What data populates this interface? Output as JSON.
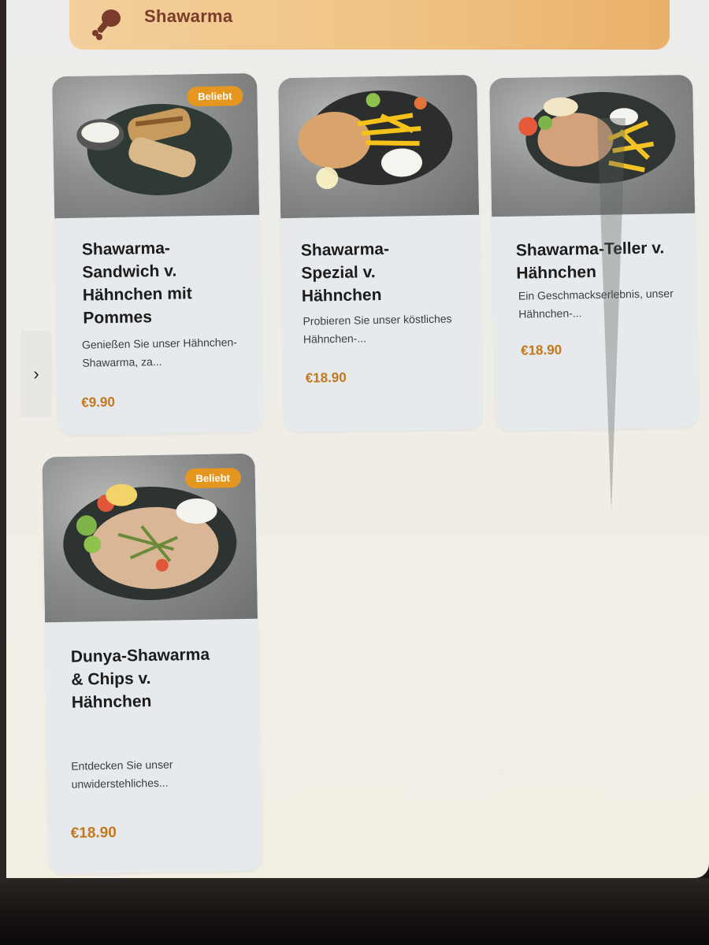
{
  "category": {
    "title": "Shawarma",
    "icon": "chicken-leg-icon",
    "accent_color": "#e5961e"
  },
  "nav": {
    "next_icon": "chevron-right-icon",
    "next_glyph": "›"
  },
  "products": [
    {
      "title": "Shawarma-Sandwich v. Hähnchen mit Pommes",
      "description": "Genießen Sie unser Hähnchen-Shawarma, za...",
      "price": "€9.90",
      "badge": "Beliebt"
    },
    {
      "title": "Shawarma-Spezial v. Hähnchen",
      "description": "Probieren Sie unser köstliches Hähnchen-...",
      "price": "€18.90",
      "badge": ""
    },
    {
      "title": "Shawarma-Teller v. Hähnchen",
      "description": "Ein Geschmackserlebnis, unser Hähnchen-...",
      "price": "€18.90",
      "badge": ""
    },
    {
      "title": "Dunya-Shawarma & Chips v. Hähnchen",
      "description": "Entdecken Sie unser unwiderstehliches...",
      "price": "€18.90",
      "badge": "Beliebt"
    }
  ]
}
